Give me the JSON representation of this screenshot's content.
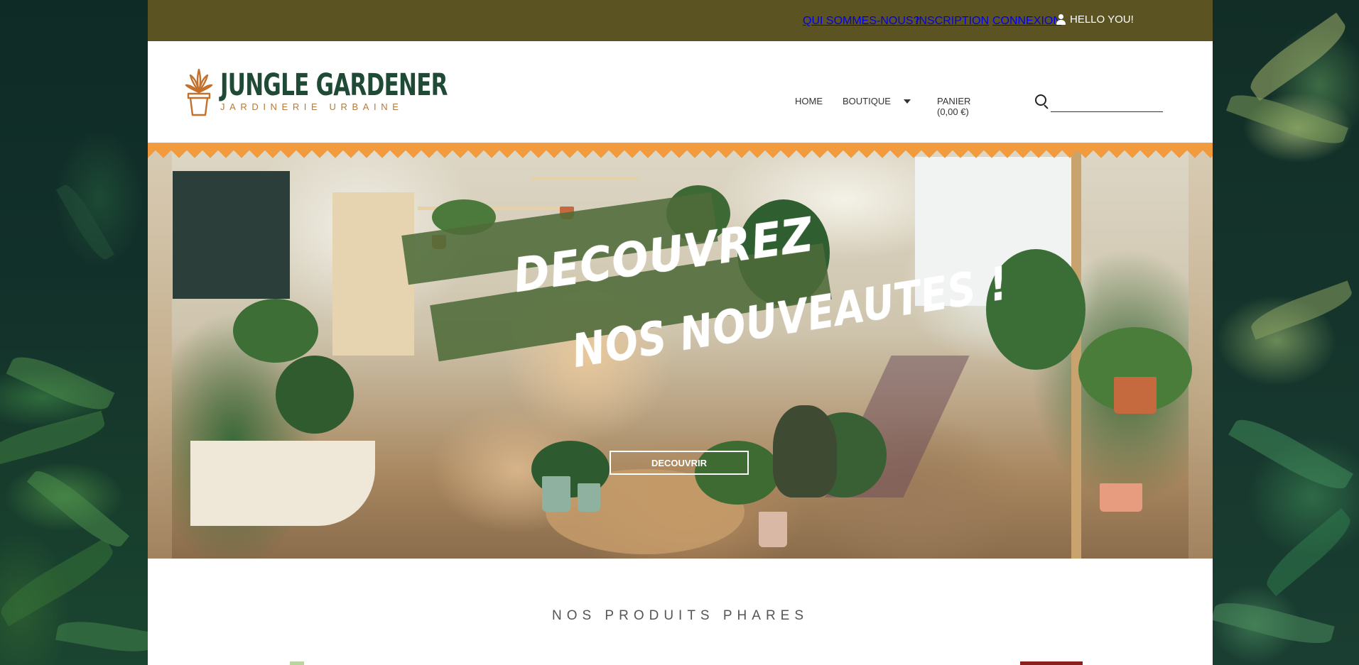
{
  "topbar": {
    "about": "QUI SOMMES-NOUS?",
    "signup": "INSCRIPTION",
    "login": "CONNEXION",
    "hello": "HELLO YOU!"
  },
  "header": {
    "logo_title": "JUNGLE GARDENER",
    "logo_subtitle": "JARDINERIE URBAINE",
    "nav": {
      "home": "HOME",
      "shop": "BOUTIQUE",
      "cart": "PANIER (0,00 €)"
    },
    "search_placeholder": ""
  },
  "hero": {
    "title_line1": "DECOUVREZ",
    "title_line2": "NOS NOUVEAUTES !",
    "button": "DECOUVRIR"
  },
  "featured": {
    "title": "NOS PRODUITS PHARES"
  },
  "colors": {
    "topbar": "#5b5321",
    "brand_green": "#1f4a35",
    "brand_orange": "#b27a3a",
    "zigzag": "#f19a3e",
    "banner_green": "#4f6b39"
  }
}
